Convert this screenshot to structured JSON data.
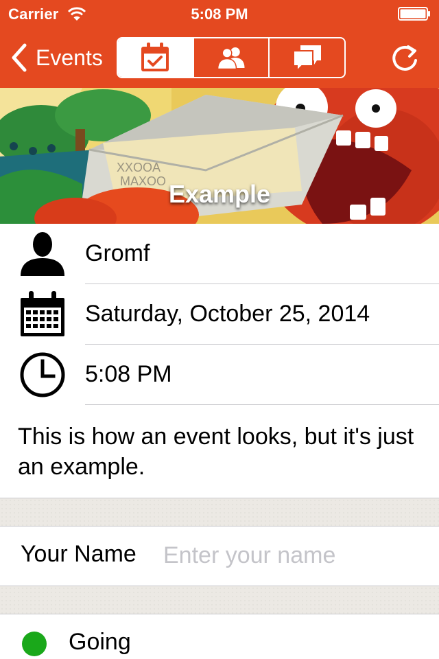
{
  "status_bar": {
    "carrier": "Carrier",
    "time": "5:08 PM"
  },
  "nav": {
    "back_label": "Events",
    "segments": [
      {
        "name": "details",
        "icon": "calendar-check-icon",
        "selected": true
      },
      {
        "name": "attendees",
        "icon": "people-icon",
        "selected": false
      },
      {
        "name": "comments",
        "icon": "chat-bubbles-icon",
        "selected": false
      }
    ],
    "refresh_icon": "refresh-icon"
  },
  "colors": {
    "nav_bar": "#e44920",
    "going": "#1aa81a"
  },
  "event": {
    "title": "Example",
    "organizer": "Gromf",
    "date": "Saturday, October 25, 2014",
    "time": "5:08 PM",
    "description": "This is how an event looks, but it's just an example."
  },
  "form": {
    "name_label": "Your Name",
    "name_placeholder": "Enter your name",
    "name_value": ""
  },
  "rsvp": {
    "going_label": "Going"
  }
}
